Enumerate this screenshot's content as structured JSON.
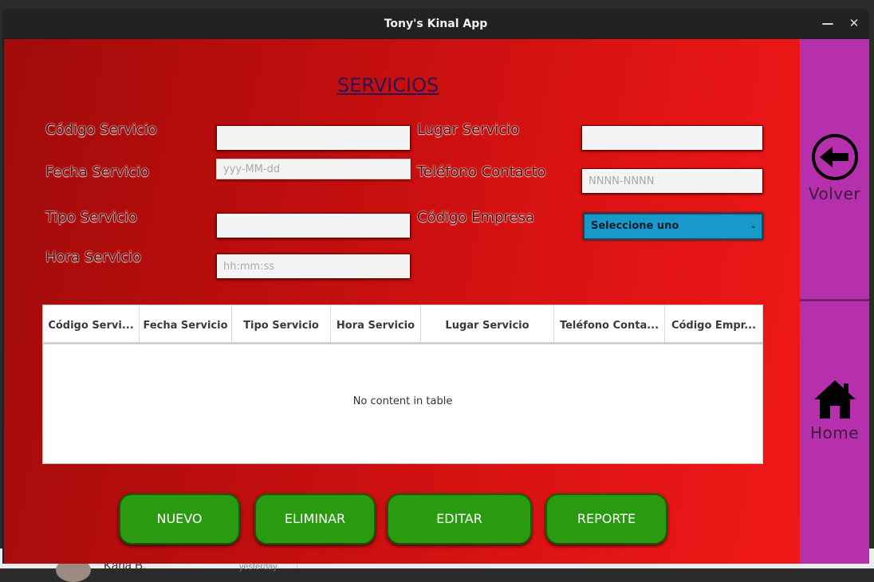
{
  "window": {
    "title": "Tony's Kinal App"
  },
  "titlebar": {
    "minimize_glyph": "—",
    "close_glyph": "✕"
  },
  "form": {
    "heading": "SERVICIOS",
    "labels": {
      "codigo_servicio": "Código Servicio",
      "fecha_servicio": "Fecha Servicio",
      "tipo_servicio": "Tipo Servicio",
      "hora_servicio": "Hora Servicio",
      "lugar_servicio": "Lugar Servicio",
      "telefono_contacto": "Teléfono Contacto",
      "codigo_empresa": "Código Empresa"
    },
    "placeholders": {
      "fecha": "yyy-MM-dd",
      "hora": "hh:mm:ss",
      "telefono": "NNNN-NNNN"
    },
    "empresa_select": {
      "selected": "Seleccione uno",
      "caret": "⌄"
    }
  },
  "table": {
    "columns": [
      "Código Servi...",
      "Fecha Servicio",
      "Tipo Servicio",
      "Hora Servicio",
      "Lugar Servicio",
      "Teléfono Conta...",
      "Código Empr..."
    ],
    "empty_message": "No content in table"
  },
  "buttons": {
    "nuevo": "NUEVO",
    "eliminar": "ELIMINAR",
    "editar": "EDITAR",
    "reporte": "REPORTE"
  },
  "sidebar": {
    "volver": {
      "label": "Volver",
      "icon": "arrow-left-circle-icon"
    },
    "home": {
      "label": "Home",
      "icon": "home-icon"
    }
  },
  "background": {
    "contact_name": "Karla B.",
    "time": "yesterday"
  },
  "colors": {
    "panel_red": "#c20e0e",
    "sidebar_purple": "#b62fac",
    "button_green": "#2a9a10",
    "select_blue": "#1899c9"
  }
}
